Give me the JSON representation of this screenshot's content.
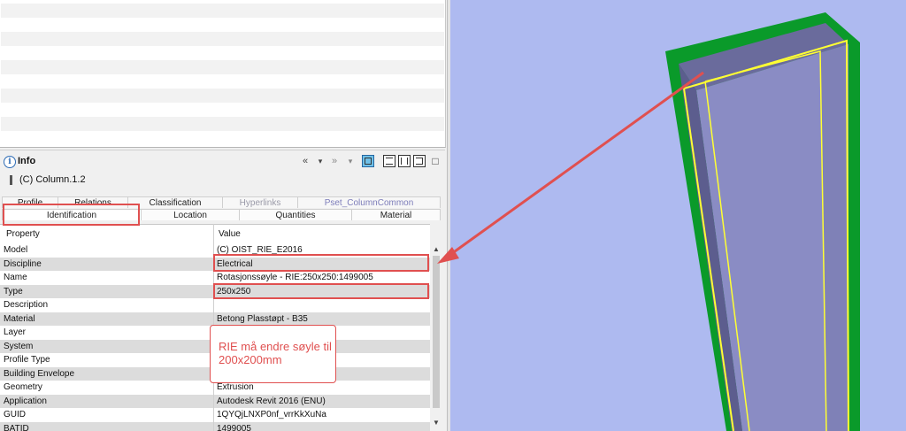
{
  "info_panel": {
    "title": "Info",
    "selected_element": "(C) Column.1.2",
    "toolbar": {
      "back_glyph": "«",
      "dropdown_glyph": "▾",
      "forward_glyph": "»",
      "forward_dropdown_glyph": "▾",
      "maximize_glyph": "□"
    },
    "tabs_back_row": [
      {
        "label": "Profile",
        "state": "normal"
      },
      {
        "label": "Relations",
        "state": "normal"
      },
      {
        "label": "Classification",
        "state": "normal"
      },
      {
        "label": "Hyperlinks",
        "state": "disabled"
      },
      {
        "label": "Pset_ColumnCommon",
        "state": "blue"
      }
    ],
    "tabs_front_row": [
      {
        "label": "Identification",
        "state": "active"
      },
      {
        "label": "Location",
        "state": "normal"
      },
      {
        "label": "Quantities",
        "state": "normal"
      },
      {
        "label": "Material",
        "state": "normal"
      }
    ],
    "grid": {
      "columns": [
        "Property",
        "Value"
      ],
      "rows": [
        {
          "property": "Model",
          "value": "(C) OIST_RIE_E2016"
        },
        {
          "property": "Discipline",
          "value": "Electrical"
        },
        {
          "property": "Name",
          "value": "Rotasjonssøyle - RIE:250x250:1499005"
        },
        {
          "property": "Type",
          "value": "250x250"
        },
        {
          "property": "Description",
          "value": ""
        },
        {
          "property": "Material",
          "value": "Betong Plasstøpt - B35"
        },
        {
          "property": "Layer",
          "value": ""
        },
        {
          "property": "System",
          "value": ""
        },
        {
          "property": "Profile Type",
          "value": ""
        },
        {
          "property": "Building Envelope",
          "value": ""
        },
        {
          "property": "Geometry",
          "value": "Extrusion"
        },
        {
          "property": "Application",
          "value": "Autodesk Revit 2016 (ENU)"
        },
        {
          "property": "GUID",
          "value": "1QYQjLNXP0nf_vrrKkXuNa"
        },
        {
          "property": "BATID",
          "value": "1499005"
        }
      ],
      "scroll_up_glyph": "▲",
      "scroll_down_glyph": "▼"
    }
  },
  "annotation": {
    "note_text": "RIE må endre søyle til 200x200mm",
    "color": "#e05050"
  },
  "viewport_3d": {
    "background_color": "#aebaf0",
    "column_outline_color": "#0a9a2a",
    "selection_color": "#ffff33",
    "column_face_color": "#8a8cc4"
  }
}
